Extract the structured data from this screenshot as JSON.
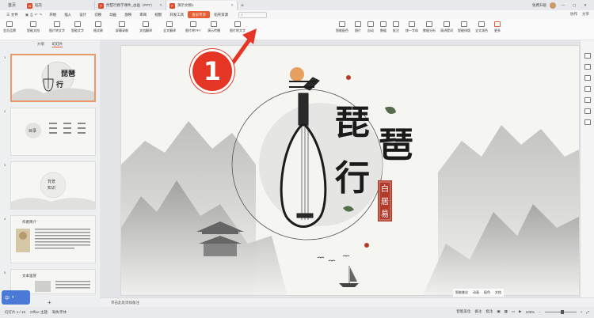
{
  "titlebar": {
    "home_tab": "首页",
    "tabs": [
      {
        "label": "稻壳",
        "icon": "P"
      },
      {
        "label": "琵琶行教学课件_古画（PPT）",
        "icon": "P"
      },
      {
        "label": "演示文稿1",
        "icon": "P"
      }
    ],
    "right_items": [
      "免费升级"
    ]
  },
  "menubar": {
    "items": [
      "三 文件",
      "开始",
      "插入",
      "设计",
      "切换",
      "动画",
      "放映",
      "审阅",
      "视图",
      "开发工具",
      "会员专享",
      "稻壳资源"
    ],
    "active": "会员专享",
    "search_placeholder": "查找命令、搜索模板",
    "right": [
      "协作",
      "分享"
    ]
  },
  "ribbon": {
    "left_buttons": [
      "会员品牌",
      "智能文档",
      "图片转文字",
      "智能文字",
      "格式刷",
      "屏幕录制",
      "文档翻译",
      "全文翻译",
      "图片转PPT",
      "演示传播",
      "图片转文字"
    ],
    "right_buttons": [
      "智能配色",
      "图片",
      "自动",
      "数据",
      "批注",
      "统一字体",
      "数据分析",
      "演讲提词",
      "智能排版",
      "全文润色",
      "更多"
    ]
  },
  "sidebar": {
    "tabs": [
      "大纲",
      "幻灯片"
    ],
    "active_tab": "幻灯片",
    "slides": [
      {
        "num": "1",
        "text": "琵琶行"
      },
      {
        "num": "2",
        "text": "目录"
      },
      {
        "num": "3",
        "text": "背景知识"
      },
      {
        "num": "4",
        "text": "作者简介"
      },
      {
        "num": "5",
        "text": "文本鉴赏"
      }
    ],
    "ime_label": "中"
  },
  "slide": {
    "title_char_1": "琵",
    "title_char_2": "琶",
    "title_char_3": "行",
    "author": "白居易"
  },
  "slide_toolbar": [
    "智能美化",
    "动画",
    "配色",
    "文档"
  ],
  "notes_placeholder": "单击此处添加备注",
  "statusbar": {
    "slide_info": "幻灯片 1 / 19",
    "theme": "Office 主题",
    "font_warning": "缺失字体",
    "smart_label": "智能美化",
    "notes_label": "备注",
    "comment_label": "批注",
    "zoom": "109%"
  },
  "annotation": {
    "label": "1"
  }
}
